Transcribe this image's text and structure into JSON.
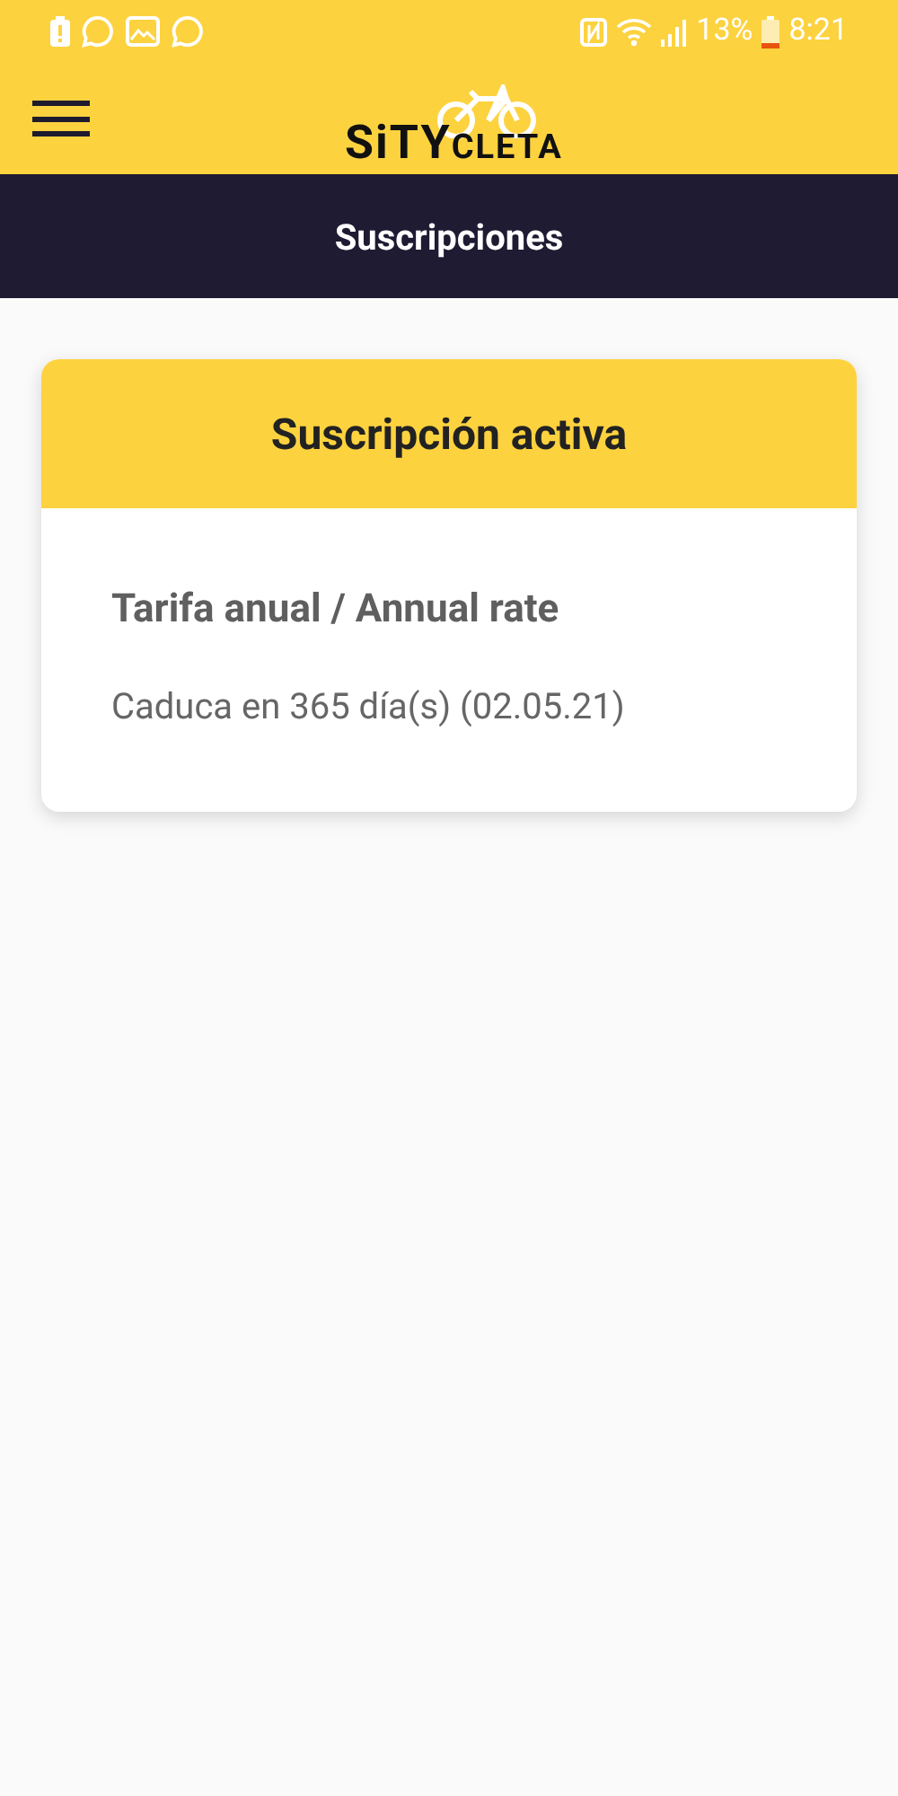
{
  "status_bar": {
    "battery_percent": "13%",
    "time": "8:21"
  },
  "header": {
    "logo": "SiTYCLETA"
  },
  "title_bar": {
    "title": "Suscripciones"
  },
  "subscription_card": {
    "heading": "Suscripción activa",
    "plan": "Tarifa anual / Annual rate",
    "expiry": "Caduca en 365 día(s) (02.05.21)"
  }
}
